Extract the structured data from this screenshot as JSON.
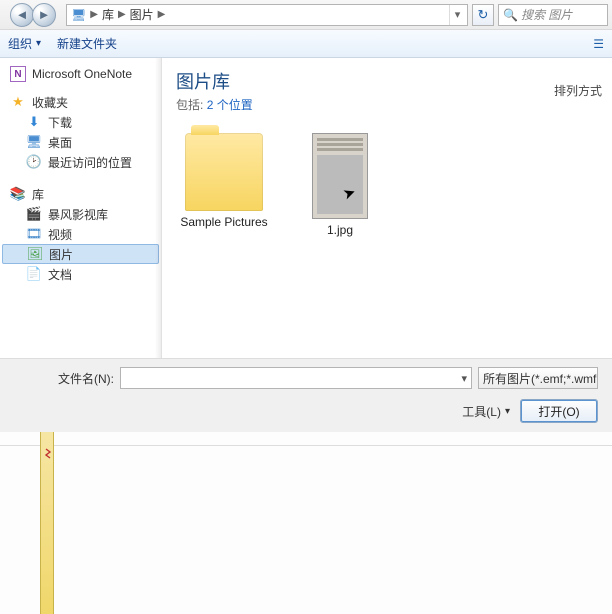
{
  "nav": {
    "crumb1": "库",
    "crumb2": "图片",
    "refresh_glyph": "↻",
    "search_placeholder": "搜索 图片"
  },
  "toolbar": {
    "organize": "组织",
    "new_folder": "新建文件夹"
  },
  "sidebar": {
    "onenote": "Microsoft OneNote",
    "favorites": "收藏夹",
    "downloads": "下载",
    "desktop": "桌面",
    "recent": "最近访问的位置",
    "libraries": "库",
    "storm": "暴风影视库",
    "videos": "视频",
    "pictures": "图片",
    "documents": "文档"
  },
  "content": {
    "title": "图片库",
    "subtitle_prefix": "包括:",
    "subtitle_link": "2 个位置",
    "arrange_label": "排列方式",
    "items": [
      {
        "label": "Sample Pictures"
      },
      {
        "label": "1.jpg"
      }
    ]
  },
  "bottom": {
    "filename_label": "文件名(N):",
    "filter_label": "所有图片(*.emf;*.wmf",
    "tools_label": "工具(L)",
    "open_label": "打开(O)"
  }
}
